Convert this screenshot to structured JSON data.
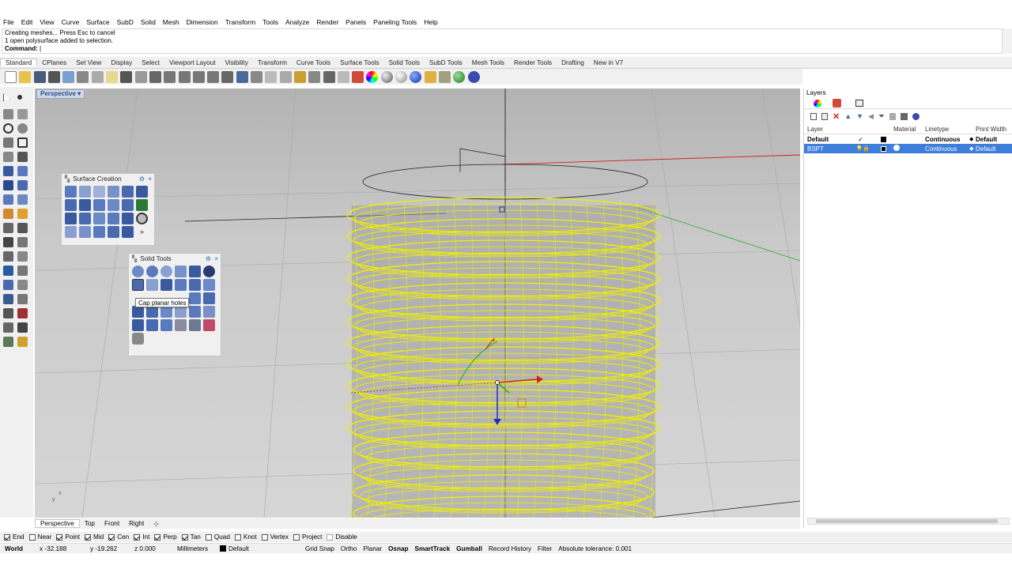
{
  "menu": [
    "File",
    "Edit",
    "View",
    "Curve",
    "Surface",
    "SubD",
    "Solid",
    "Mesh",
    "Dimension",
    "Transform",
    "Tools",
    "Analyze",
    "Render",
    "Panels",
    "Paneling Tools",
    "Help"
  ],
  "command_history": [
    "Creating meshes... Press Esc to cancel",
    "1 open polysurface added to selection."
  ],
  "command_prompt": "Command:",
  "toolbar_tabs": [
    "Standard",
    "CPlanes",
    "Set View",
    "Display",
    "Select",
    "Viewport Layout",
    "Visibility",
    "Transform",
    "Curve Tools",
    "Surface Tools",
    "Solid Tools",
    "SubD Tools",
    "Mesh Tools",
    "Render Tools",
    "Drafting",
    "New in V7"
  ],
  "viewport": {
    "title": "Perspective"
  },
  "view_tabs": [
    "Perspective",
    "Top",
    "Front",
    "Right"
  ],
  "surface_panel": {
    "title": "Surface Creation"
  },
  "solid_panel": {
    "title": "Solid Tools"
  },
  "tooltip": "Cap planar holes",
  "layers": {
    "title": "Layers",
    "columns": [
      "Layer",
      "Material",
      "Linetype",
      "Print Width"
    ],
    "rows": [
      {
        "name": "Default",
        "linetype": "Continuous",
        "print_width": "Default",
        "current": "✓"
      },
      {
        "name": "BSPT",
        "linetype": "Continuous",
        "print_width": "Default",
        "current": ""
      }
    ]
  },
  "osnaps": [
    {
      "label": "End",
      "on": true
    },
    {
      "label": "Near",
      "on": false
    },
    {
      "label": "Point",
      "on": true
    },
    {
      "label": "Mid",
      "on": true
    },
    {
      "label": "Cen",
      "on": true
    },
    {
      "label": "Int",
      "on": true
    },
    {
      "label": "Perp",
      "on": true
    },
    {
      "label": "Tan",
      "on": true
    },
    {
      "label": "Quad",
      "on": false
    },
    {
      "label": "Knot",
      "on": false
    },
    {
      "label": "Vertex",
      "on": false
    },
    {
      "label": "Project",
      "on": false
    },
    {
      "label": "Disable",
      "on": false
    }
  ],
  "status": {
    "cplane": "World",
    "x": "x -32.188",
    "y": "y -19.262",
    "z": "z 0.000",
    "units": "Millimeters",
    "layer": "Default",
    "toggles": [
      "Grid Snap",
      "Ortho",
      "Planar",
      "Osnap",
      "SmartTrack",
      "Gumball",
      "Record History",
      "Filter"
    ],
    "tolerance": "Absolute tolerance: 0.001"
  },
  "colors": {
    "accent": "#3d7edb",
    "wire": "#f0f000",
    "xaxis": "#d02020",
    "yaxis": "#20b020"
  }
}
